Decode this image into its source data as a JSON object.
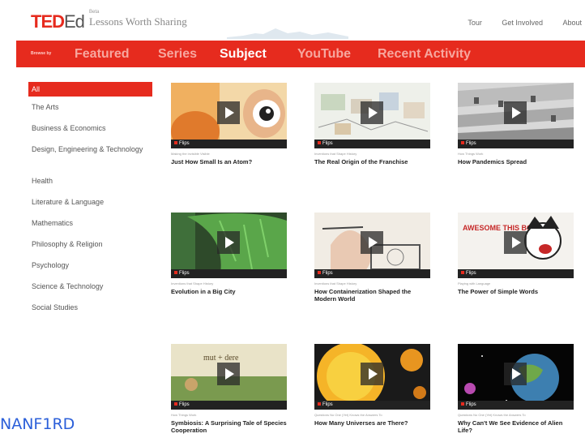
{
  "header": {
    "logo_ted": "TED",
    "logo_ed": "Ed",
    "tagline_small": "Beta",
    "tagline": "Lessons Worth Sharing",
    "links": [
      "Tour",
      "Get Involved",
      "About"
    ]
  },
  "nav": {
    "browse_label": "Browse by",
    "items": [
      "Featured",
      "Series",
      "Subject",
      "YouTube",
      "Recent Activity"
    ],
    "active": "Subject"
  },
  "sidebar": {
    "items": [
      "All",
      "The Arts",
      "Business & Economics",
      "Design, Engineering & Technology",
      "Health",
      "Literature & Language",
      "Mathematics",
      "Philosophy & Religion",
      "Psychology",
      "Science & Technology",
      "Social Studies"
    ],
    "active": "All"
  },
  "cards": [
    {
      "series": "Making the invisible Visible",
      "title": "Just How Small Is an Atom?",
      "flips": "Flips"
    },
    {
      "series": "Inventions that Shape History",
      "title": "The Real Origin of the Franchise",
      "flips": "Flips"
    },
    {
      "series": "How Things Work",
      "title": "How Pandemics Spread",
      "flips": "Flips"
    },
    {
      "series": "Inventions that Shape History",
      "title": "Evolution in a Big City",
      "flips": "Flips"
    },
    {
      "series": "Inventions that Shape History",
      "title": "How Containerization Shaped the Modern World",
      "flips": "Flips"
    },
    {
      "series": "Playing with Language",
      "title": "The Power of Simple Words",
      "flips": "Flips"
    },
    {
      "series": "How Things Work",
      "title": "Symbiosis: A Surprising Tale of Species Cooperation",
      "flips": "Flips"
    },
    {
      "series": "Questions No One (Yet) Knows the Answers To",
      "title": "How Many Universes are There?",
      "flips": "Flips"
    },
    {
      "series": "Questions No One (Yet) Knows the Answers To",
      "title": "Why Can't We See Evidence of Alien Life?",
      "flips": "Flips"
    }
  ],
  "thumb_text": {
    "card5": "AWESOME THIS BORING",
    "card6": "mut + dere"
  },
  "watermark": "NANF1RD",
  "colors": {
    "accent": "#e62b1e"
  }
}
